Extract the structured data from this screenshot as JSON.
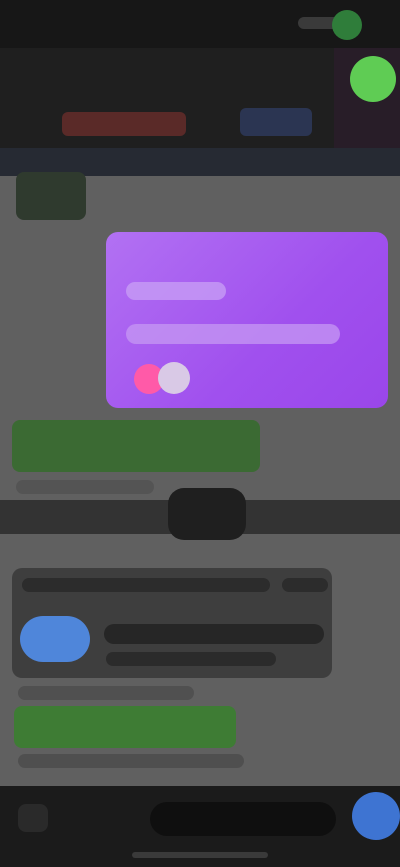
{
  "status_bar": {
    "time": ""
  },
  "header": {
    "back_label": "",
    "title": ""
  },
  "colors": {
    "accent_green": "#5fcc54",
    "accent_purple": "#a050ee",
    "accent_blue": "#3e74d2"
  },
  "icons": {
    "back": "chevron-left-icon",
    "send": "send-icon",
    "attach": "plus-icon"
  }
}
